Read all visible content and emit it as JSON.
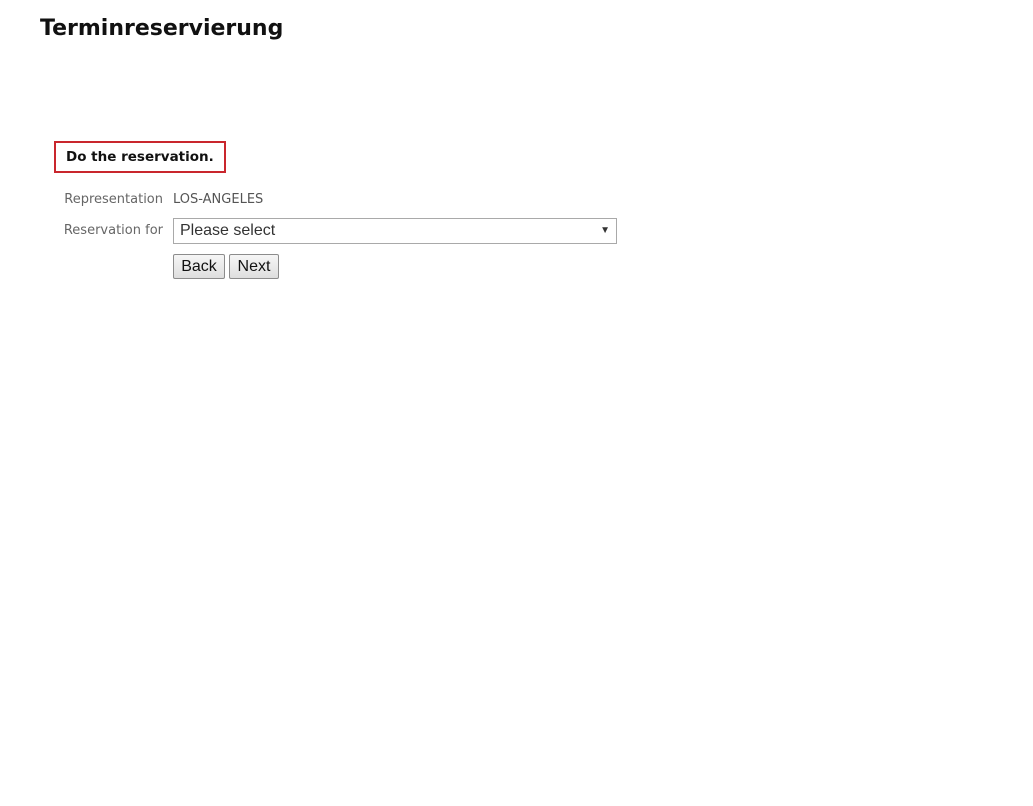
{
  "page": {
    "title": "Terminreservierung"
  },
  "notice": {
    "text": "Do the reservation."
  },
  "form": {
    "representation": {
      "label": "Representation",
      "value": "LOS-ANGELES"
    },
    "reservation_for": {
      "label": "Reservation for",
      "selected": "Please select"
    }
  },
  "buttons": {
    "back_label": "Back",
    "next_label": "Next"
  },
  "icons": {
    "select_caret": "chevron-down-icon"
  },
  "colors": {
    "notice_border": "#c9262d",
    "label_text": "#666666"
  }
}
